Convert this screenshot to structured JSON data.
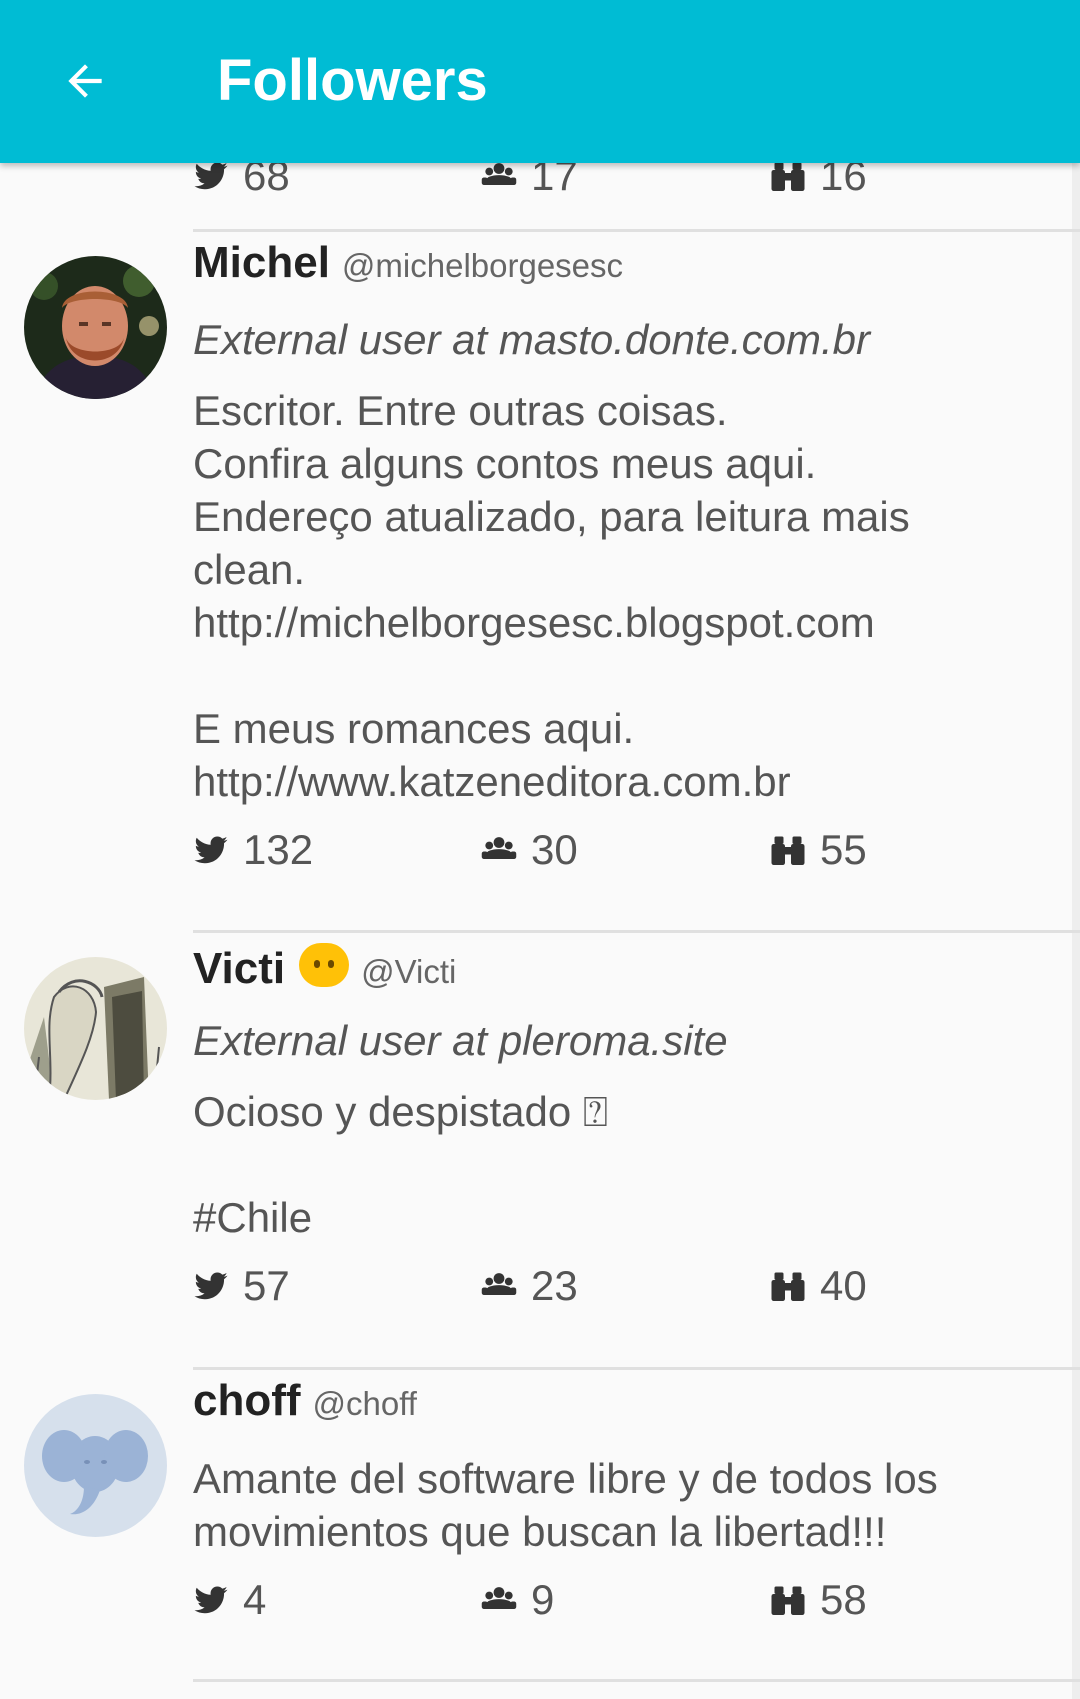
{
  "appbar": {
    "title": "Followers",
    "back_icon": "arrow-left-icon"
  },
  "colors": {
    "primary": "#00bcd4",
    "divider": "#e0e0e0"
  },
  "partial_entry": {
    "stats": {
      "statuses": "68",
      "following": "17",
      "followers": "16"
    }
  },
  "followers": [
    {
      "name": "Michel",
      "handle": "@michelborgesesc",
      "external": "External user at masto.donte.com.br",
      "note": "Escritor. Entre outras coisas.\nConfira alguns contos meus aqui.\nEndereço atualizado, para leitura mais clean.\nhttp://michelborgesesc.blogspot.com\n\nE meus romances aqui.\nhttp://www.katzeneditora.com.br",
      "stats": {
        "statuses": "132",
        "following": "30",
        "followers": "55"
      }
    },
    {
      "name": "Victi",
      "handle": "@Victi",
      "external": "External user at pleroma.site",
      "note": "Ocioso y despistado ⍰\n\n#Chile",
      "stats": {
        "statuses": "57",
        "following": "23",
        "followers": "40"
      }
    },
    {
      "name": "choff",
      "handle": "@choff",
      "note": "Amante del software libre y de todos los movimientos que buscan la libertad!!!",
      "stats": {
        "statuses": "4",
        "following": "9",
        "followers": "58"
      }
    }
  ]
}
